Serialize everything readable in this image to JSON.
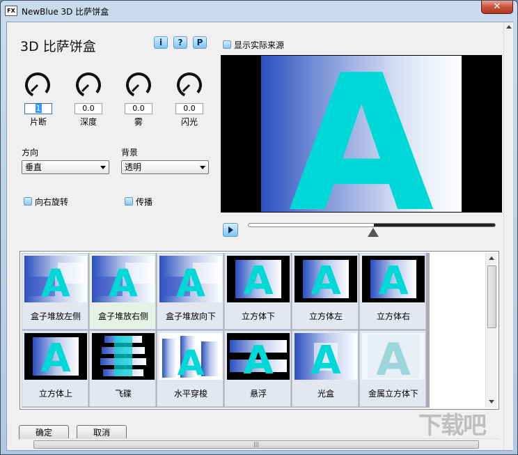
{
  "window": {
    "title": "NewBlue 3D 比萨饼盒",
    "icon_text": "FX",
    "close_label": "✕"
  },
  "header": {
    "plugin_title": "3D 比萨饼盒",
    "buttons": {
      "info": "i",
      "help": "?",
      "preset": "P"
    }
  },
  "knobs": [
    {
      "label": "片断",
      "value": "1"
    },
    {
      "label": "深度",
      "value": "0.0"
    },
    {
      "label": "雾",
      "value": "0.0"
    },
    {
      "label": "闪光",
      "value": "0.0"
    }
  ],
  "direction": {
    "label": "方向",
    "selected": "垂直"
  },
  "background": {
    "label": "背景",
    "selected": "透明"
  },
  "checkboxes": {
    "rotate_right": "向右旋转",
    "propagate": "传播",
    "show_source": "显示实际来源"
  },
  "preview": {
    "letter": "A"
  },
  "playback": {
    "position": 0.5
  },
  "gallery": {
    "presets": [
      {
        "label": "盒子堆放左侧"
      },
      {
        "label": "盒子堆放右侧"
      },
      {
        "label": "盒子堆放向下"
      },
      {
        "label": "立方体下"
      },
      {
        "label": "立方体左"
      },
      {
        "label": "立方体右"
      },
      {
        "label": "立方体上"
      },
      {
        "label": "飞碟"
      },
      {
        "label": "水平穿梭"
      },
      {
        "label": "悬浮"
      },
      {
        "label": "光盒"
      },
      {
        "label": "金属立方体下"
      }
    ]
  },
  "footer": {
    "ok": "确定",
    "cancel": "取消"
  },
  "watermark": "下载吧",
  "colors": {
    "accent_cyan": "#00d8d8",
    "gradient_blue": "#2a4fc0"
  }
}
